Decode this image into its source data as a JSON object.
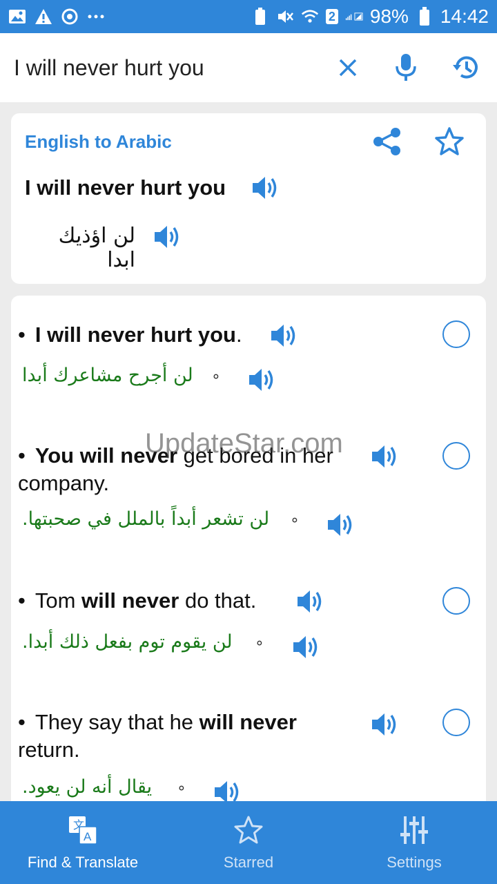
{
  "status_bar": {
    "sim_badge": "2",
    "battery": "98%",
    "time": "14:42"
  },
  "search": {
    "query": "I will never hurt you"
  },
  "translation": {
    "lang_pair": "English to Arabic",
    "source": "I will never hurt you",
    "target": "لن اؤذيك ابدا"
  },
  "examples": [
    {
      "parts": [
        {
          "t": "I will never hurt you",
          "b": true
        },
        {
          "t": ".",
          "b": false
        }
      ],
      "arabic": "لن أجرح مشاعرك أبدا"
    },
    {
      "parts": [
        {
          "t": "You will never",
          "b": true
        },
        {
          "t": " get bored in her company.",
          "b": false
        }
      ],
      "arabic": "لن تشعر أبداً بالملل في صحبتها."
    },
    {
      "parts": [
        {
          "t": "Tom ",
          "b": false
        },
        {
          "t": "will never",
          "b": true
        },
        {
          "t": " do that.",
          "b": false
        }
      ],
      "arabic": "لن يقوم توم بفعل ذلك أبدا."
    },
    {
      "parts": [
        {
          "t": "They say that he ",
          "b": false
        },
        {
          "t": "will never",
          "b": true
        },
        {
          "t": " return.",
          "b": false
        }
      ],
      "arabic": "يقال أنه لن يعود."
    }
  ],
  "watermark": "UpdateStar.com",
  "bottom_nav": [
    {
      "label": "Find & Translate",
      "icon": "translate-icon",
      "active": true
    },
    {
      "label": "Starred",
      "icon": "star-icon",
      "active": false
    },
    {
      "label": "Settings",
      "icon": "sliders-icon",
      "active": false
    }
  ],
  "colors": {
    "accent": "#2f86d9",
    "arabic_example": "#1a7a1a"
  }
}
